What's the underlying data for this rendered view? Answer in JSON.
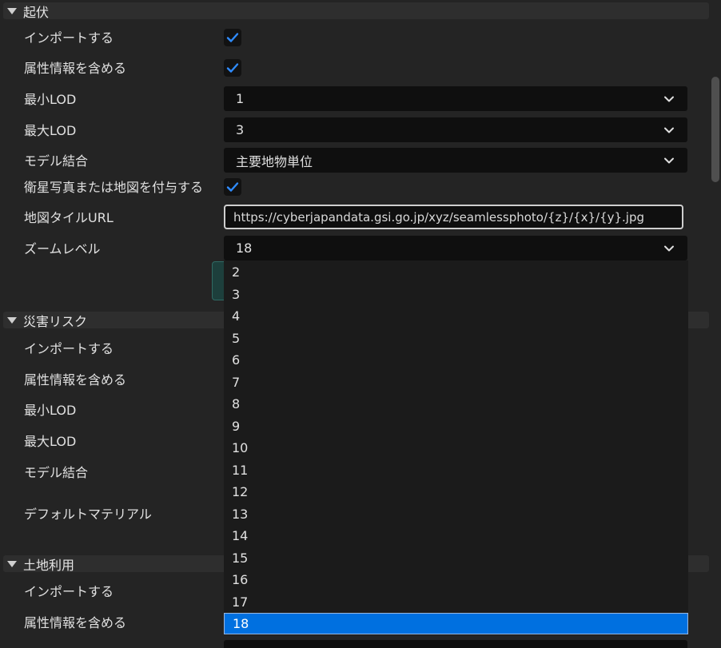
{
  "sections": {
    "relief": {
      "title": "起伏",
      "import_label": "インポートする",
      "attributes_label": "属性情報を含める",
      "min_lod_label": "最小LOD",
      "min_lod_value": "1",
      "max_lod_label": "最大LOD",
      "max_lod_value": "3",
      "merge_label": "モデル結合",
      "merge_value": "主要地物単位",
      "satellite_label": "衛星写真または地図を付与する",
      "tile_url_label": "地図タイルURL",
      "tile_url_value": "https://cyberjapandata.gsi.go.jp/xyz/seamlessphoto/{z}/{x}/{y}.jpg",
      "zoom_label": "ズームレベル",
      "zoom_value": "18"
    },
    "disaster": {
      "title": "災害リスク",
      "import_label": "インポートする",
      "attributes_label": "属性情報を含める",
      "min_lod_label": "最小LOD",
      "max_lod_label": "最大LOD",
      "merge_label": "モデル結合",
      "material_label": "デフォルトマテリアル"
    },
    "landuse": {
      "title": "土地利用",
      "import_label": "インポートする",
      "attributes_label": "属性情報を含める"
    }
  },
  "zoom_dropdown": {
    "options": [
      "2",
      "3",
      "4",
      "5",
      "6",
      "7",
      "8",
      "9",
      "10",
      "11",
      "12",
      "13",
      "14",
      "15",
      "16",
      "17",
      "18"
    ],
    "selected": "18"
  },
  "colors": {
    "accent": "#0070e0",
    "check": "#2f8cff",
    "background": "#242424",
    "field": "#0f0f0f"
  },
  "icons": {
    "collapse": "triangle-down-icon",
    "checkmark": "checkmark-icon",
    "dropdown": "chevron-down-icon"
  }
}
